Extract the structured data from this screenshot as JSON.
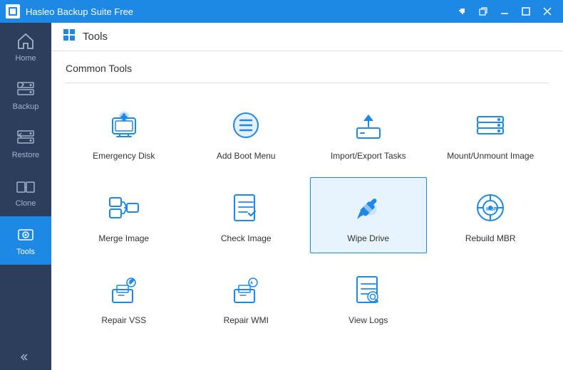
{
  "titlebar": {
    "title": "Hasleo Backup Suite Free",
    "btn_minimize": "—",
    "btn_maximize": "□",
    "btn_close": "✕",
    "btn_restore": "⊡",
    "btn_help": "?"
  },
  "sidebar": {
    "items": [
      {
        "id": "home",
        "label": "Home",
        "active": false
      },
      {
        "id": "backup",
        "label": "Backup",
        "active": false
      },
      {
        "id": "restore",
        "label": "Restore",
        "active": false
      },
      {
        "id": "clone",
        "label": "Clone",
        "active": false
      },
      {
        "id": "tools",
        "label": "Tools",
        "active": true
      }
    ],
    "collapse_label": "«"
  },
  "header": {
    "icon": "tools-icon",
    "title": "Tools"
  },
  "content": {
    "section_title": "Common Tools",
    "tools": [
      {
        "id": "emergency-disk",
        "label": "Emergency Disk",
        "selected": false
      },
      {
        "id": "add-boot-menu",
        "label": "Add Boot Menu",
        "selected": false
      },
      {
        "id": "import-export-tasks",
        "label": "Import/Export Tasks",
        "selected": false
      },
      {
        "id": "mount-unmount-image",
        "label": "Mount/Unmount Image",
        "selected": false
      },
      {
        "id": "merge-image",
        "label": "Merge Image",
        "selected": false
      },
      {
        "id": "check-image",
        "label": "Check Image",
        "selected": false
      },
      {
        "id": "wipe-drive",
        "label": "Wipe Drive",
        "selected": true
      },
      {
        "id": "rebuild-mbr",
        "label": "Rebuild MBR",
        "selected": false
      },
      {
        "id": "repair-vss",
        "label": "Repair VSS",
        "selected": false
      },
      {
        "id": "repair-wmi",
        "label": "Repair WMI",
        "selected": false
      },
      {
        "id": "view-logs",
        "label": "View Logs",
        "selected": false
      }
    ]
  }
}
